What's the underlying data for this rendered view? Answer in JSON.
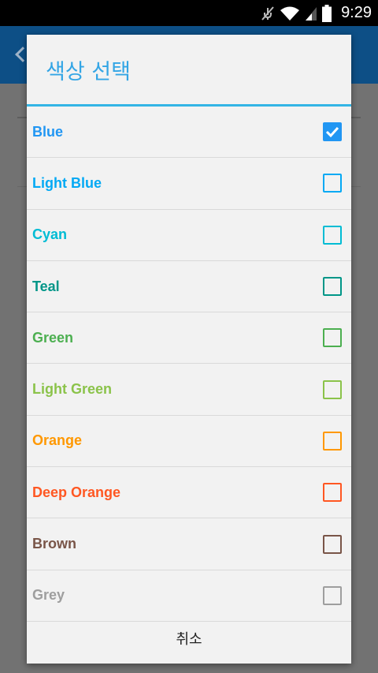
{
  "status_bar": {
    "time": "9:29",
    "icons": [
      "mute-icon",
      "wifi-icon",
      "signal-icon",
      "battery-icon"
    ]
  },
  "dialog": {
    "title": "색상 선택",
    "accent_color": "#33b5e5",
    "items": [
      {
        "label": "Blue",
        "color": "#2196F3",
        "checked": true
      },
      {
        "label": "Light Blue",
        "color": "#03A9F4",
        "checked": false
      },
      {
        "label": "Cyan",
        "color": "#00BCD4",
        "checked": false
      },
      {
        "label": "Teal",
        "color": "#009688",
        "checked": false
      },
      {
        "label": "Green",
        "color": "#4CAF50",
        "checked": false
      },
      {
        "label": "Light Green",
        "color": "#8BC34A",
        "checked": false
      },
      {
        "label": "Orange",
        "color": "#FF9800",
        "checked": false
      },
      {
        "label": "Deep Orange",
        "color": "#FF5722",
        "checked": false
      },
      {
        "label": "Brown",
        "color": "#795548",
        "checked": false
      },
      {
        "label": "Grey",
        "color": "#9E9E9E",
        "checked": false
      }
    ],
    "cancel_label": "취소"
  }
}
